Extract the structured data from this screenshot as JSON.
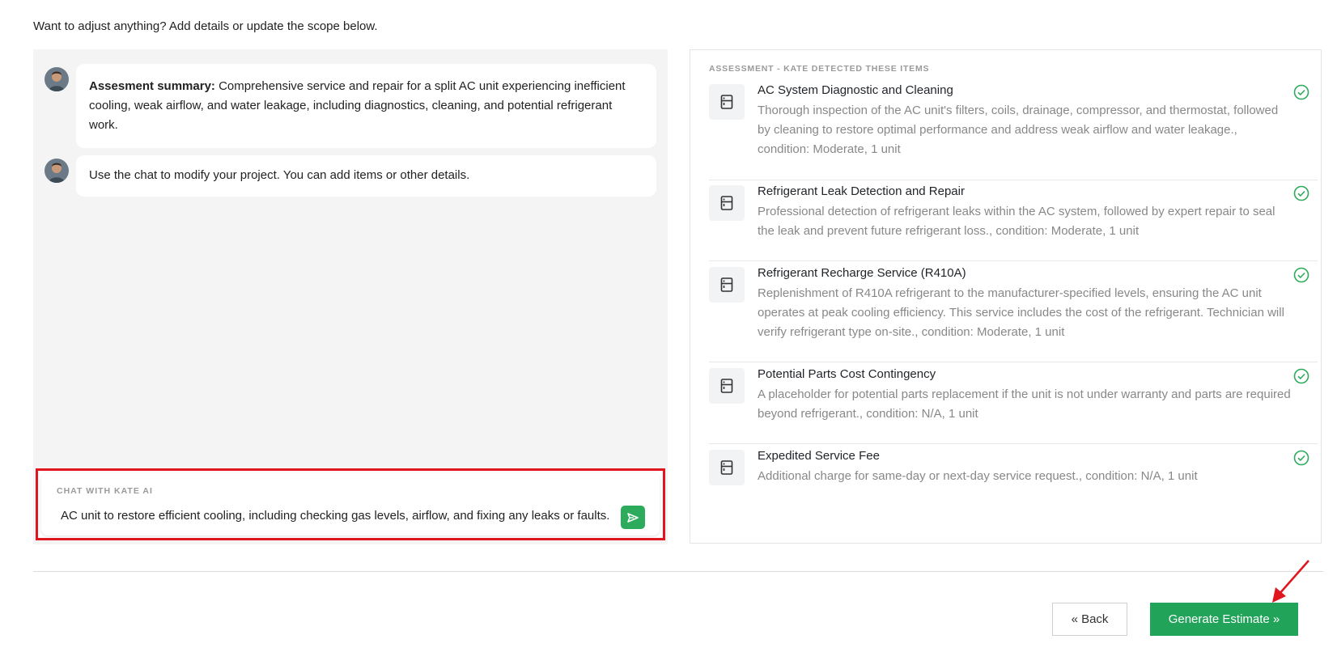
{
  "intro_text": "Want to adjust anything? Add details or update the scope below.",
  "chat": {
    "messages": [
      {
        "bold_prefix": "Assesment summary:",
        "text": " Comprehensive service and repair for a split AC unit experiencing inefficient cooling, weak airflow, and water leakage, including diagnostics, cleaning, and potential refrigerant work."
      },
      {
        "bold_prefix": "",
        "text": "Use the chat to modify your project. You can add items or other details."
      }
    ],
    "input_label": "CHAT WITH KATE AI",
    "input_value": "AC unit to restore efficient cooling, including checking gas levels, airflow, and fixing any leaks or faults.",
    "send_icon": "send-icon"
  },
  "assessment": {
    "title": "ASSESSMENT - KATE DETECTED THESE ITEMS",
    "items": [
      {
        "title": "AC System Diagnostic and Cleaning",
        "desc": "Thorough inspection of the AC unit's filters, coils, drainage, compressor, and thermostat, followed by cleaning to restore optimal performance and address weak airflow and water leakage., condition: Moderate, 1 unit"
      },
      {
        "title": "Refrigerant Leak Detection and Repair",
        "desc": "Professional detection of refrigerant leaks within the AC system, followed by expert repair to seal the leak and prevent future refrigerant loss., condition: Moderate, 1 unit"
      },
      {
        "title": "Refrigerant Recharge Service (R410A)",
        "desc": "Replenishment of R410A refrigerant to the manufacturer-specified levels, ensuring the AC unit operates at peak cooling efficiency. This service includes the cost of the refrigerant. Technician will verify refrigerant type on-site., condition: Moderate, 1 unit"
      },
      {
        "title": "Potential Parts Cost Contingency",
        "desc": "A placeholder for potential parts replacement if the unit is not under warranty and parts are required beyond refrigerant., condition: N/A, 1 unit"
      },
      {
        "title": "Expedited Service Fee",
        "desc": "Additional charge for same-day or next-day service request., condition: N/A, 1 unit"
      }
    ]
  },
  "buttons": {
    "back": "« Back",
    "generate": "Generate Estimate »"
  },
  "colors": {
    "accent_green": "#22a35a",
    "highlight_red": "#e0161f"
  }
}
